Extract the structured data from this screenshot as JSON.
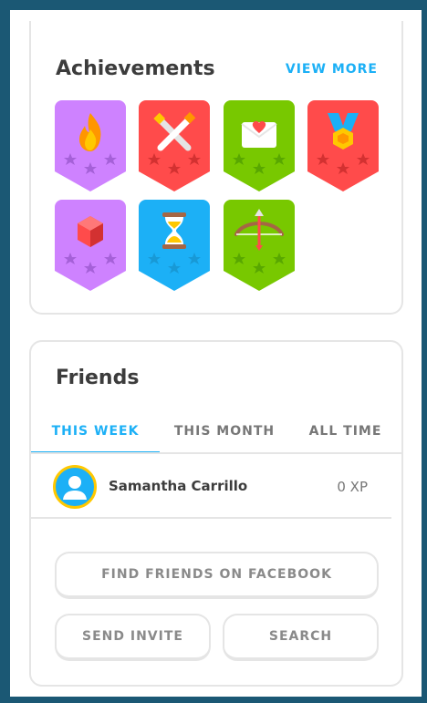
{
  "achievements": {
    "title": "Achievements",
    "view_more": "VIEW MORE",
    "badges": [
      {
        "name": "flame",
        "color": "#ce82ff"
      },
      {
        "name": "swords",
        "color": "#ff4b4b"
      },
      {
        "name": "envelope-heart",
        "color": "#78c800"
      },
      {
        "name": "medal",
        "color": "#ff4b4b"
      },
      {
        "name": "gem",
        "color": "#ce82ff"
      },
      {
        "name": "hourglass",
        "color": "#1cb0f6"
      },
      {
        "name": "bow-arrow",
        "color": "#78c800"
      }
    ]
  },
  "friends": {
    "title": "Friends",
    "tabs": [
      {
        "label": "THIS WEEK",
        "active": true
      },
      {
        "label": "THIS MONTH",
        "active": false
      },
      {
        "label": "ALL TIME",
        "active": false
      }
    ],
    "list": [
      {
        "name": "Samantha Carrillo",
        "xp": "0 XP"
      }
    ],
    "find_facebook": "FIND FRIENDS ON FACEBOOK",
    "send_invite": "SEND INVITE",
    "search": "SEARCH"
  },
  "colors": {
    "accent": "#1cb0f6",
    "frame": "#1b5874"
  }
}
